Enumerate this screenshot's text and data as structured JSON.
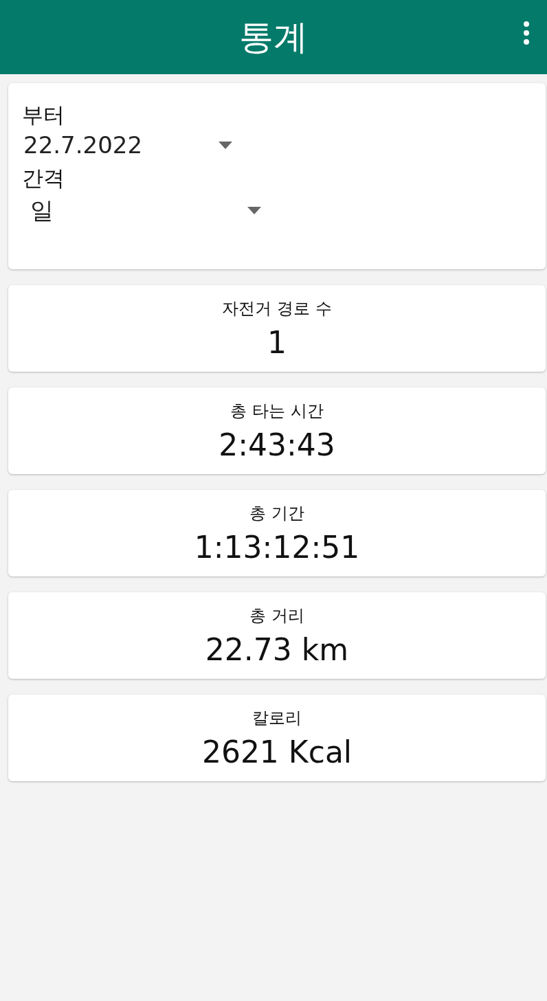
{
  "app_bar": {
    "title": "통계"
  },
  "filters": [
    {
      "label": "부터",
      "value": "22.7.2022"
    },
    {
      "label": "간격",
      "value": "일"
    }
  ],
  "stats": [
    {
      "label": "자전거 경로 수",
      "value": "1"
    },
    {
      "label": "총 타는 시간",
      "value": "2:43:43"
    },
    {
      "label": "총 기간",
      "value": "1:13:12:51"
    },
    {
      "label": "총 거리",
      "value": "22.73 km"
    },
    {
      "label": "칼로리",
      "value": "2621 Kcal"
    }
  ]
}
